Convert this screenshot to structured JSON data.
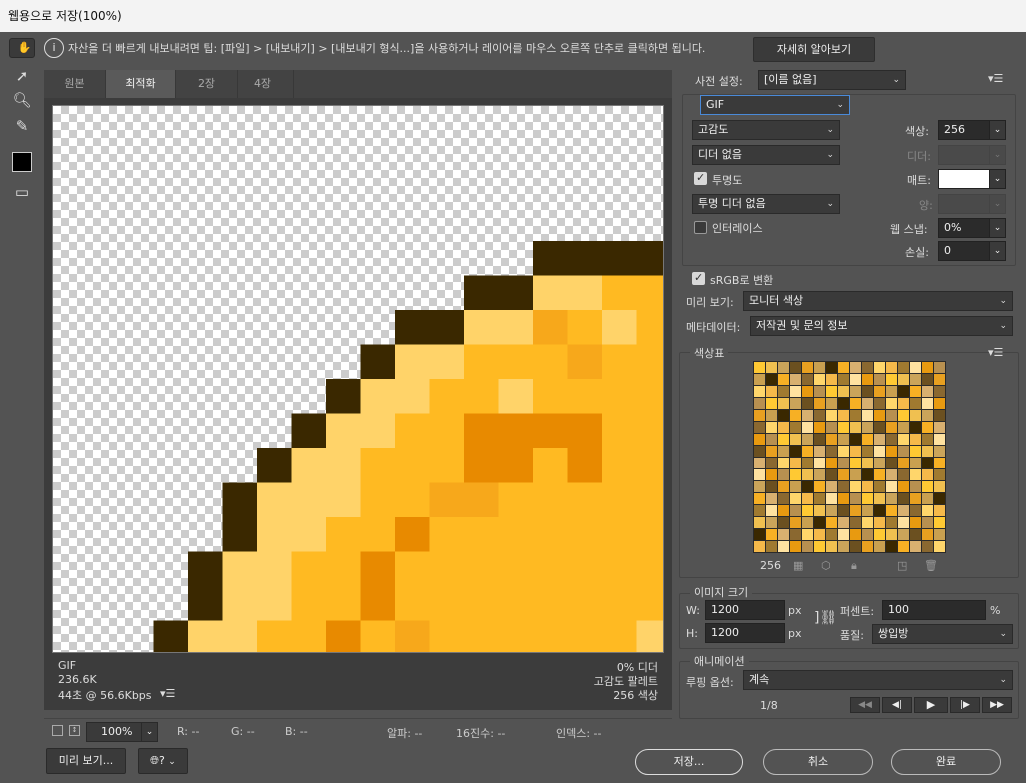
{
  "window": {
    "title": "웹용으로 저장(100%)"
  },
  "info": {
    "text": "자산을 더 빠르게 내보내려면 팁: [파일] > [내보내기] > [내보내기 형식...]을 사용하거나 레이어를 마우스 오른쪽 단추로 클릭하면 됩니다.",
    "more_button": "자세히 알아보기"
  },
  "tabs": [
    "원본",
    "최적화",
    "2장",
    "4장"
  ],
  "canvas_info": {
    "format": "GIF",
    "size": "236.6K",
    "time": "44초 @ 56.6Kbps",
    "dither": "0% 디더",
    "palette": "고감도 팔레트",
    "colors": "256 색상"
  },
  "bottom": {
    "zoom": "100%",
    "r": "R: --",
    "g": "G: --",
    "b": "B: --",
    "alpha": "알파: --",
    "hex": "16진수: --",
    "index": "인덱스: --"
  },
  "buttons": {
    "preview": "미리 보기...",
    "save": "저장...",
    "cancel": "취소",
    "done": "완료"
  },
  "settings": {
    "preset_label": "사전 설정:",
    "preset_value": "[이름 없음]",
    "format": "GIF",
    "reduction": "고감도",
    "colors_label": "색상:",
    "colors_value": "256",
    "dither_algo": "디더 없음",
    "dither_label": "디더:",
    "transparency_label": "투명도",
    "matte_label": "매트:",
    "trans_dither": "투명 디더 없음",
    "amount_label": "양:",
    "interlace_label": "인터레이스",
    "websnap_label": "웹 스냅:",
    "websnap_value": "0%",
    "lossy_label": "손실:",
    "lossy_value": "0",
    "srgb_label": "sRGB로 변환",
    "preview_label": "미리 보기:",
    "preview_value": "모니터 색상",
    "metadata_label": "메타데이터:",
    "metadata_value": "저작권 및 문의 정보"
  },
  "color_table": {
    "title": "색상표",
    "count": "256"
  },
  "image_size": {
    "title": "이미지 크기",
    "w_label": "W:",
    "w_value": "1200",
    "h_label": "H:",
    "h_value": "1200",
    "unit": "px",
    "percent_label": "퍼센트:",
    "percent_value": "100",
    "percent_unit": "%",
    "quality_label": "품질:",
    "quality_value": "쌍입방"
  },
  "animation": {
    "title": "애니메이션",
    "loop_label": "루핑 옵션:",
    "loop_value": "계속",
    "frame": "1/8"
  },
  "colors": {
    "bg": "#535353",
    "dark_brown": "#3a2800",
    "light_yellow": "#ffd369",
    "yellow": "#ffba22",
    "orange": "#f7a81b",
    "dark_orange": "#e88a00"
  }
}
